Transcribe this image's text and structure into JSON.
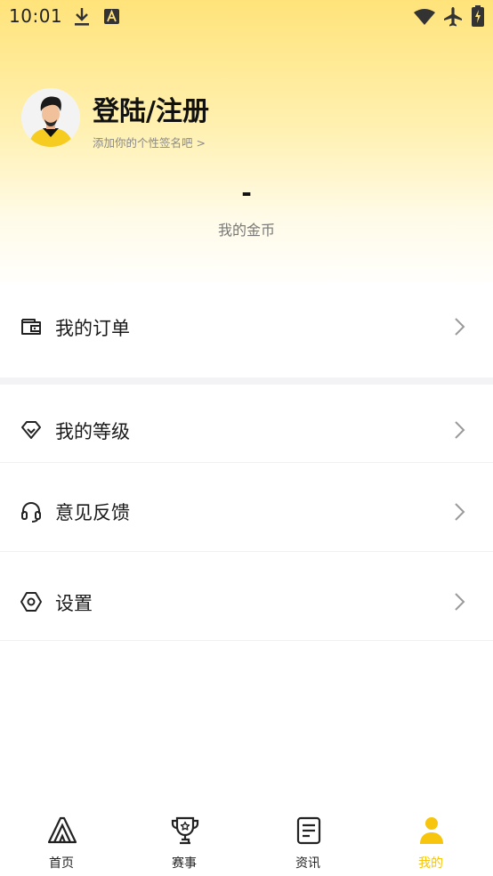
{
  "status_bar": {
    "time": "10:01",
    "icons": [
      "download-icon",
      "a-letter-icon",
      "wifi-icon",
      "airplane-icon",
      "battery-charging-icon"
    ]
  },
  "profile": {
    "name": "登陆/注册",
    "signature": "添加你的个性签名吧 >",
    "avatar_icon": "user-avatar"
  },
  "coins": {
    "value": "-",
    "label": "我的金币"
  },
  "menu": {
    "items": [
      {
        "label": "我的订单",
        "icon": "wallet-icon"
      },
      {
        "label": "我的等级",
        "icon": "diamond-icon"
      },
      {
        "label": "意见反馈",
        "icon": "headset-icon"
      },
      {
        "label": "设置",
        "icon": "hexagon-settings-icon"
      }
    ]
  },
  "bottom_nav": {
    "items": [
      {
        "label": "首页",
        "icon": "home-a-logo-icon",
        "active": false
      },
      {
        "label": "赛事",
        "icon": "trophy-icon",
        "active": false
      },
      {
        "label": "资讯",
        "icon": "news-icon",
        "active": false
      },
      {
        "label": "我的",
        "icon": "person-icon",
        "active": true
      }
    ]
  },
  "colors": {
    "accent": "#f7c50d",
    "header_gradient_top": "#ffe37a",
    "text_primary": "#1a1a1a",
    "text_secondary": "#888888",
    "separator": "#f3f3f6"
  }
}
